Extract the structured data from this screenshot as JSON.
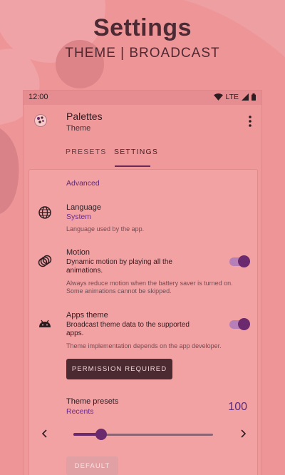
{
  "hero": {
    "title": "Settings",
    "subtitle": "THEME | BROADCAST"
  },
  "status_bar": {
    "time": "12:00",
    "network": "LTE",
    "icons": [
      "wifi-icon",
      "signal-icon",
      "battery-icon"
    ]
  },
  "app_bar": {
    "title": "Palettes",
    "subtitle": "Theme",
    "icon": "palette-icon",
    "menu_icon": "more-vert-icon"
  },
  "tabs": [
    {
      "label": "PRESETS",
      "active": false
    },
    {
      "label": "SETTINGS",
      "active": true
    }
  ],
  "settings": {
    "section_title": "Advanced",
    "language": {
      "icon": "globe-icon",
      "title": "Language",
      "value": "System",
      "note": "Language used by the app."
    },
    "motion": {
      "icon": "motion-icon",
      "title": "Motion",
      "summary": "Dynamic motion by playing all the animations.",
      "note": "Always reduce motion when the battery saver is turned on. Some animations cannot be skipped.",
      "enabled": true
    },
    "apps_theme": {
      "icon": "android-icon",
      "title": "Apps theme",
      "summary": "Broadcast theme data to the supported apps.",
      "note": "Theme implementation depends on the app developer.",
      "enabled": true,
      "button_label": "PERMISSION REQUIRED"
    },
    "theme_presets": {
      "title": "Theme presets",
      "value": "Recents",
      "count": "100",
      "slider_fraction": 0.2,
      "prev_icon": "chevron-left-icon",
      "next_icon": "chevron-right-icon",
      "default_button": "DEFAULT"
    }
  },
  "colors": {
    "background": "#ee9598",
    "accent": "#6b2a6e",
    "dark": "#4b2a31"
  }
}
